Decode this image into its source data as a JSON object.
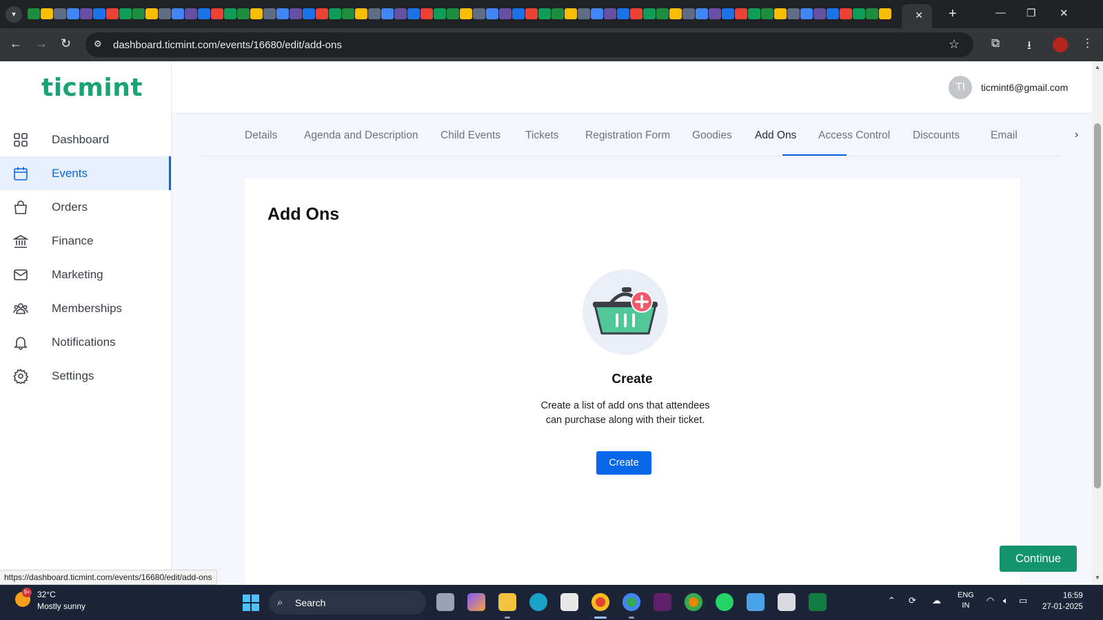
{
  "browser": {
    "tab_close_glyph": "✕",
    "new_tab_glyph": "+",
    "url": "dashboard.ticmint.com/events/16680/edit/add-ons",
    "status_url": "https://dashboard.ticmint.com/events/16680/edit/add-ons"
  },
  "app": {
    "logo": "ticmint",
    "user_initials": "TI",
    "user_email": "ticmint6@gmail.com"
  },
  "sidebar": {
    "items": [
      {
        "label": "Dashboard",
        "icon": "grid-icon",
        "active": false
      },
      {
        "label": "Events",
        "icon": "calendar-icon",
        "active": true
      },
      {
        "label": "Orders",
        "icon": "shopping-bag-icon",
        "active": false
      },
      {
        "label": "Finance",
        "icon": "bank-icon",
        "active": false
      },
      {
        "label": "Marketing",
        "icon": "mail-icon",
        "active": false
      },
      {
        "label": "Memberships",
        "icon": "users-icon",
        "active": false
      },
      {
        "label": "Notifications",
        "icon": "bell-icon",
        "active": false
      },
      {
        "label": "Settings",
        "icon": "gear-icon",
        "active": false
      }
    ]
  },
  "tabs": [
    {
      "label": "Details"
    },
    {
      "label": "Agenda and Description"
    },
    {
      "label": "Child Events"
    },
    {
      "label": "Tickets"
    },
    {
      "label": "Registration Form"
    },
    {
      "label": "Goodies"
    },
    {
      "label": "Add Ons",
      "active": true
    },
    {
      "label": "Access Control"
    },
    {
      "label": "Discounts"
    },
    {
      "label": "Email"
    }
  ],
  "main": {
    "title": "Add Ons",
    "empty_state": {
      "heading": "Create",
      "description": "Create a list of add ons that attendees can purchase along with their ticket.",
      "button": "Create"
    },
    "continue_button": "Continue"
  },
  "colors": {
    "brand": "#1aa374",
    "primary": "#0a66e8",
    "continue": "#14946b"
  },
  "taskbar": {
    "weather_temp": "32°C",
    "weather_desc": "Mostly sunny",
    "weather_badge": "9+",
    "search_label": "Search",
    "language": "ENG",
    "region": "IN",
    "time": "16:59",
    "date": "27-01-2025"
  }
}
